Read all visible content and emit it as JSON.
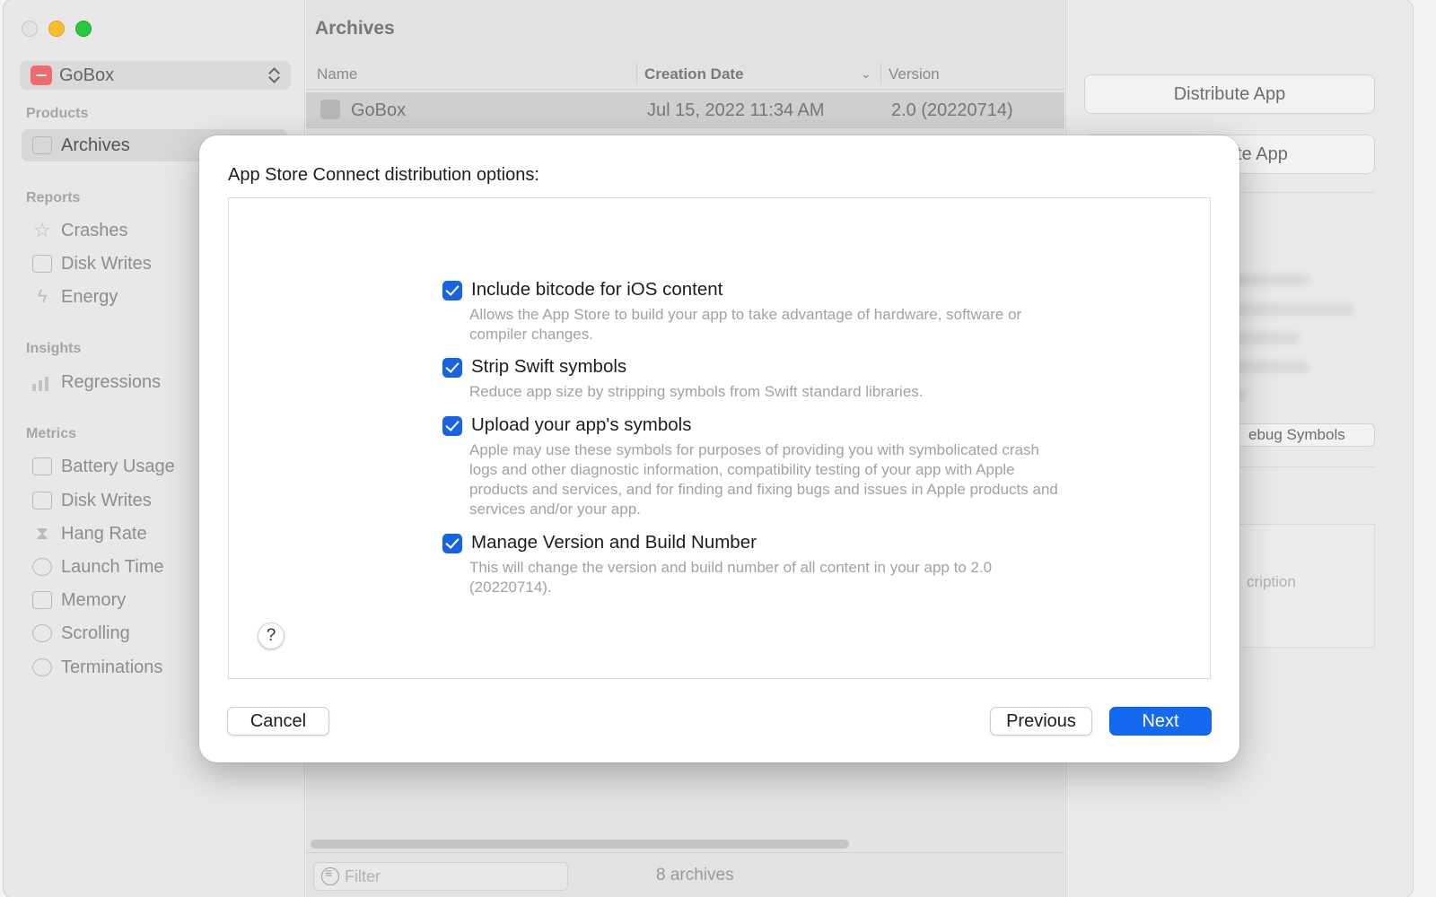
{
  "sidebar": {
    "app_name": "GoBox",
    "sections": [
      {
        "title": "Products",
        "items": [
          "Archives"
        ]
      },
      {
        "title": "Reports",
        "items": [
          "Crashes",
          "Disk Writes",
          "Energy"
        ]
      },
      {
        "title": "Insights",
        "items": [
          "Regressions"
        ]
      },
      {
        "title": "Metrics",
        "items": [
          "Battery Usage",
          "Disk Writes",
          "Hang Rate",
          "Launch Time",
          "Memory",
          "Scrolling",
          "Terminations"
        ]
      }
    ],
    "selected": "Archives"
  },
  "archives": {
    "title": "Archives",
    "columns": {
      "name": "Name",
      "creation_date": "Creation Date",
      "version": "Version"
    },
    "rows": [
      {
        "name": "GoBox",
        "date": "Jul 15, 2022 11:34 AM",
        "version": "2.0 (20220714)"
      }
    ],
    "filter_placeholder": "Filter",
    "count": "8 archives"
  },
  "inspector": {
    "distribute_button": "Distribute App",
    "validate_button_partial": "ate App",
    "debug_symbols_partial": "ebug Symbols",
    "description_partial": "cription"
  },
  "dialog": {
    "title": "App Store Connect distribution options:",
    "options": [
      {
        "label": "Include bitcode for iOS content",
        "checked": true,
        "description": "Allows the App Store to build your app to take advantage of hardware, software or compiler changes."
      },
      {
        "label": "Strip Swift symbols",
        "checked": true,
        "description": "Reduce app size by stripping symbols from Swift standard libraries."
      },
      {
        "label": "Upload your app's symbols",
        "checked": true,
        "description": "Apple may use these symbols for purposes of providing you with symbolicated crash logs and other diagnostic information, compatibility testing of your app with Apple products and services, and for finding and fixing bugs and issues in Apple products and services and/or your app."
      },
      {
        "label": "Manage Version and Build Number",
        "checked": true,
        "description": "This will change the version and build number of all content in your app to 2.0 (20220714)."
      }
    ],
    "help_label": "?",
    "cancel_label": "Cancel",
    "previous_label": "Previous",
    "next_label": "Next"
  },
  "colors": {
    "accent": "#1569f1",
    "checkbox": "#1763e6",
    "traffic_min": "#fbbd2e",
    "traffic_zoom": "#2ac93f"
  }
}
